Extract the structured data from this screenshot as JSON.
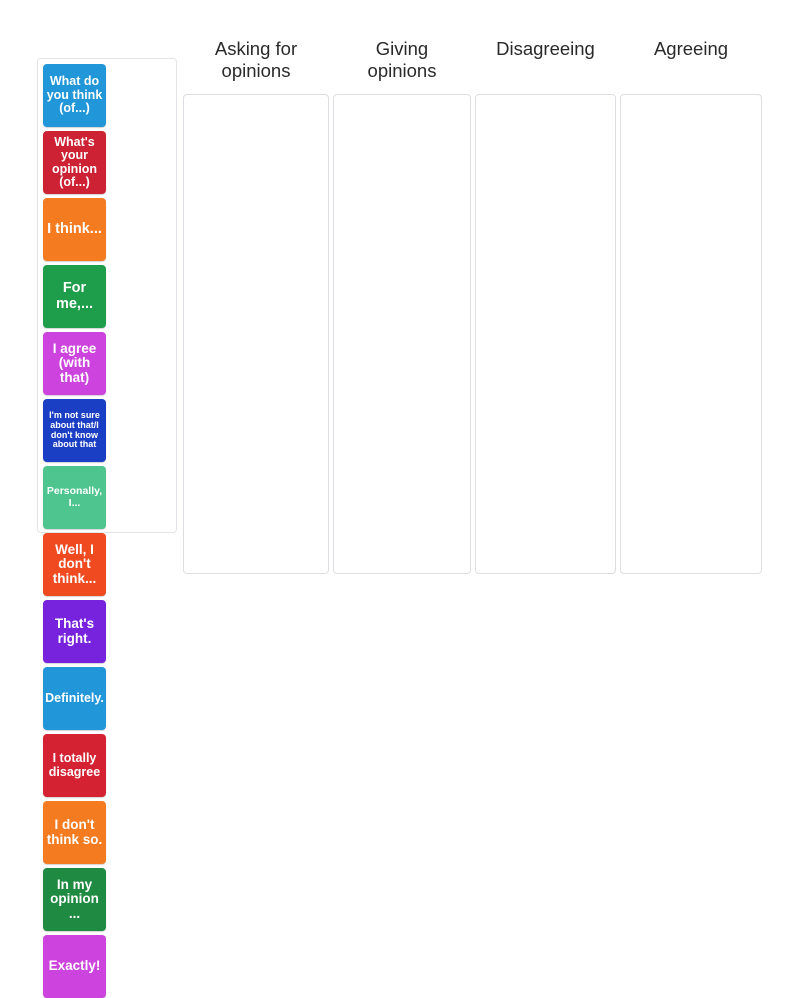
{
  "activity": {
    "type": "group-sort",
    "tile_tray_label": "Draggable phrase tiles"
  },
  "tiles": [
    {
      "text": "What do you think (of...)",
      "color": "#2196d9",
      "size": "fs-md",
      "name": "tile-what-do-you-think"
    },
    {
      "text": "What's your opinion (of...)",
      "color": "#cc2233",
      "size": "fs-md",
      "name": "tile-whats-your-opinion"
    },
    {
      "text": "I think...",
      "color": "#f47b20",
      "size": "fs-xl",
      "name": "tile-i-think"
    },
    {
      "text": "For me,...",
      "color": "#1e9e4a",
      "size": "fs-xl",
      "name": "tile-for-me"
    },
    {
      "text": "I agree (with that)",
      "color": "#cc44dd",
      "size": "fs-lg",
      "name": "tile-i-agree-with-that"
    },
    {
      "text": "I'm not sure about that/I don't know about that",
      "color": "#1b3fc4",
      "size": "fs-xs",
      "name": "tile-im-not-sure-about-that"
    },
    {
      "text": "Personally, I...",
      "color": "#4ec48f",
      "size": "fs-sm",
      "name": "tile-personally-i"
    },
    {
      "text": "Well, I don't think...",
      "color": "#ef4a20",
      "size": "fs-lg",
      "name": "tile-well-i-dont-think"
    },
    {
      "text": "That's right.",
      "color": "#7722dd",
      "size": "fs-lg",
      "name": "tile-thats-right"
    },
    {
      "text": "Definitely.",
      "color": "#2196d9",
      "size": "fs-md",
      "name": "tile-definitely"
    },
    {
      "text": "I totally disagree",
      "color": "#d42233",
      "size": "fs-md",
      "name": "tile-i-totally-disagree"
    },
    {
      "text": "I don't think so.",
      "color": "#f47b20",
      "size": "fs-lg",
      "name": "tile-i-dont-think-so"
    },
    {
      "text": "In my opinion ...",
      "color": "#1e8a42",
      "size": "fs-lg",
      "name": "tile-in-my-opinion"
    },
    {
      "text": "Exactly!",
      "color": "#cc44dd",
      "size": "fs-lg",
      "name": "tile-exactly"
    }
  ],
  "columns": [
    {
      "title": "Asking for\nopinions",
      "width_class": "w-asking",
      "name": "column-asking-for-opinions"
    },
    {
      "title": "Giving\nopinions",
      "width_class": "w-giving",
      "name": "column-giving-opinions"
    },
    {
      "title": "Disagreeing",
      "width_class": "w-disagree",
      "name": "column-disagreeing"
    },
    {
      "title": "Agreeing",
      "width_class": "w-agree",
      "name": "column-agreeing"
    }
  ]
}
